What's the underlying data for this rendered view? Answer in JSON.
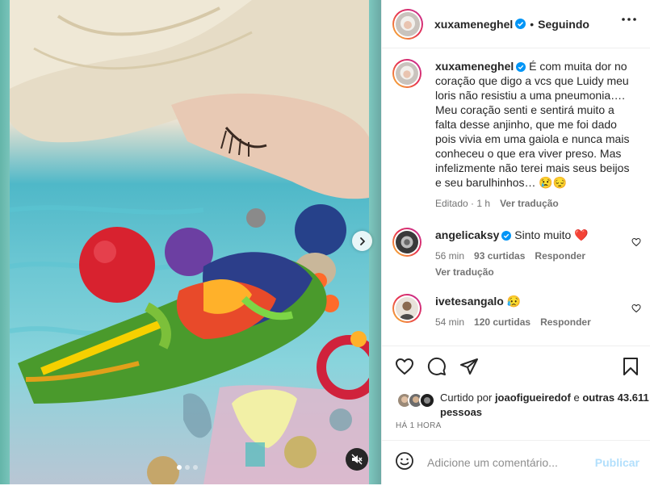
{
  "post": {
    "username": "xuxameneghel",
    "follow_status": "Seguindo",
    "separator": "•"
  },
  "caption": {
    "username": "xuxameneghel",
    "text": "É com muita dor no coração que digo a vcs que Luidy meu loris não resistiu a uma pneumonia…. Meu coração senti e sentirá muito a falta desse anjinho, que me foi dado pois vivia em uma gaiola e nunca mais conheceu o que era viver preso. Mas infelizmente não terei mais seus beijos e seu barulhinhos… 😢😔",
    "edited": "Editado",
    "time": "1 h",
    "translate": "Ver tradução"
  },
  "comments": [
    {
      "username": "angelicaksy",
      "text": "Sinto muito ❤️",
      "time": "56 min",
      "likes": "93 curtidas",
      "reply": "Responder",
      "translate": "Ver tradução"
    },
    {
      "username": "ivetesangalo",
      "text": "😥",
      "time": "54 min",
      "likes": "120 curtidas",
      "reply": "Responder"
    }
  ],
  "likes": {
    "prefix": "Curtido por",
    "user": "joaofigueiredof",
    "conj": "e",
    "others": "outras 43.611 pessoas"
  },
  "time_ago": "HÁ 1 HORA",
  "comment_box": {
    "placeholder": "Adicione um comentário...",
    "publish": "Publicar"
  },
  "carousel": {
    "slides": 3,
    "active": 0
  },
  "colors": {
    "verified": "#0095f6",
    "publish_disabled": "#b2dffc",
    "heart_red": "#ed4956",
    "muted_text": "#737373"
  }
}
